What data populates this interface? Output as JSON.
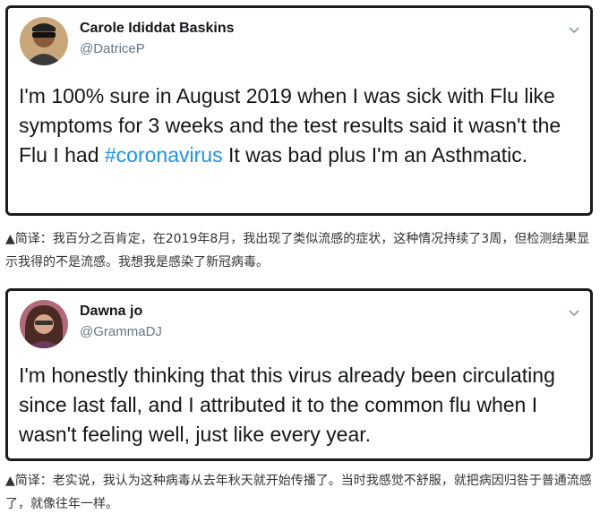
{
  "tweets": [
    {
      "name": "Carole Ididdat Baskins",
      "handle": "@DatriceP",
      "text_before": "I'm 100% sure in August 2019 when I was sick with Flu like symptoms for 3 weeks and the test results said it wasn't the Flu I had ",
      "hashtag": "#coronavirus",
      "text_after": " It was bad plus I'm an Asthmatic.",
      "avatar_icon": "profile-photo-man-sunglasses"
    },
    {
      "name": "Dawna jo",
      "handle": "@GrammaDJ",
      "text": "I'm honestly thinking that this virus already been circulating since last fall, and I attributed it to the common flu when I wasn't feeling well, just like every year.",
      "avatar_icon": "profile-photo-woman"
    }
  ],
  "captions": [
    "▲简译：我百分之百肯定，在2019年8月，我出现了类似流感的症状，这种情况持续了3周，但检测结果显示我得的不是流感。我想我是感染了新冠病毒。",
    "▲简译：老实说，我认为这种病毒从去年秋天就开始传播了。当时我感觉不舒服，就把病因归咎于普通流感了，就像往年一样。"
  ],
  "icons": {
    "menu": "chevron-down-icon"
  },
  "colors": {
    "hashtag": "#1b95e0",
    "handle": "#657786",
    "border": "#1c1c1c"
  }
}
